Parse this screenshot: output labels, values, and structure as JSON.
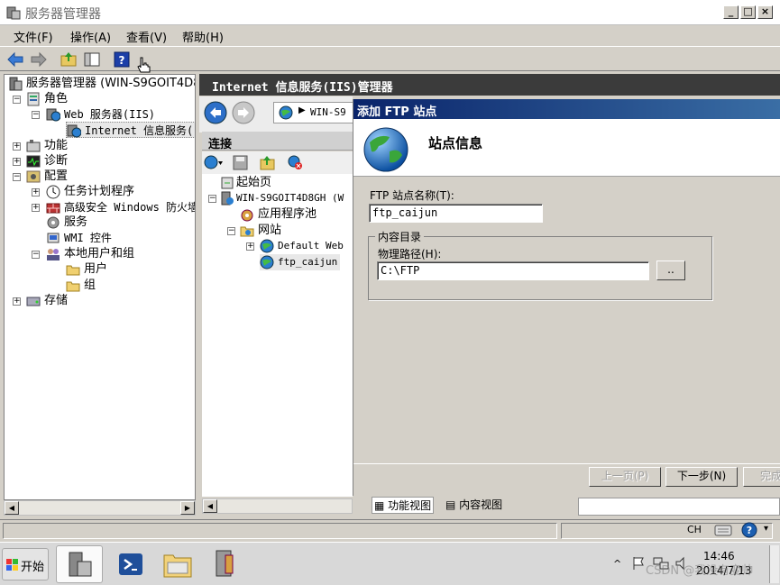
{
  "window": {
    "title": "服务器管理器"
  },
  "menu": [
    "文件(F)",
    "操作(A)",
    "查看(V)",
    "帮助(H)"
  ],
  "tree": {
    "root": "服务器管理器 (WIN-S9GOIT4D8G",
    "roles": "角色",
    "web_server": "Web 服务器(IIS)",
    "iis": "Internet 信息服务(",
    "features": "功能",
    "diagnostics": "诊断",
    "config": "配置",
    "task_scheduler": "任务计划程序",
    "firewall": "高级安全 Windows 防火墙",
    "services": "服务",
    "wmi": "WMI 控件",
    "local_users": "本地用户和组",
    "users": "用户",
    "groups": "组",
    "storage": "存储"
  },
  "iis": {
    "header": "Internet 信息服务(IIS)管理器",
    "address": "WIN-S9",
    "connections": "连接",
    "start_page": "起始页",
    "server": "WIN-S9GOIT4D8GH (W",
    "app_pools": "应用程序池",
    "sites": "网站",
    "default_web": "Default Web",
    "ftp_site": "ftp_caijun",
    "feature_view": "功能视图",
    "content_view": "内容视图"
  },
  "dialog": {
    "title": "添加 FTP 站点",
    "heading": "站点信息",
    "site_name_label": "FTP 站点名称(T):",
    "site_name_value": "ftp_caijun",
    "content_group": "内容目录",
    "path_label": "物理路径(H):",
    "path_value": "C:\\FTP",
    "browse": "..",
    "prev": "上一页(P)",
    "next": "下一步(N)",
    "finish": "完成"
  },
  "taskbar": {
    "start": "开始",
    "lang": "CH",
    "time": "14:46",
    "date": "2014/7/13"
  },
  "watermark": "CSDN @我没有变帅"
}
